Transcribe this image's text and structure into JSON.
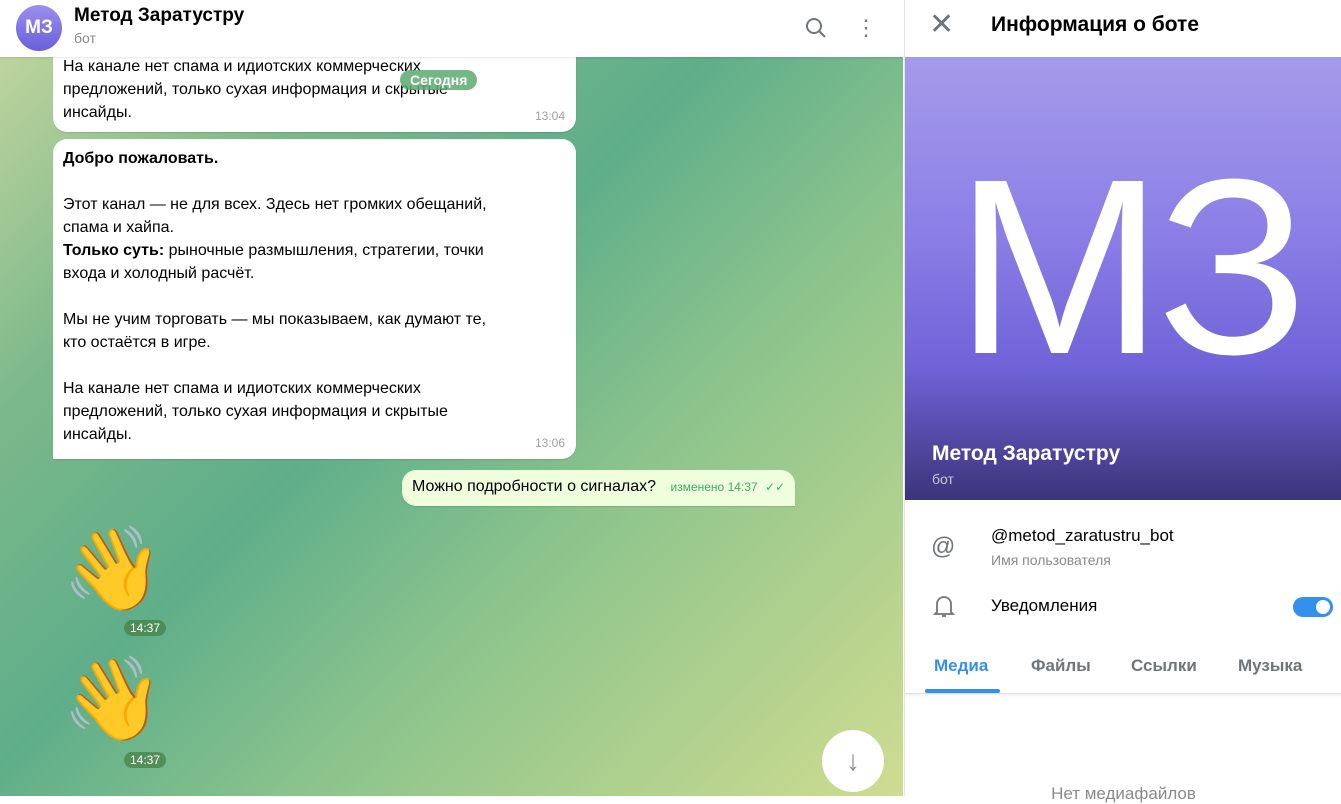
{
  "chat": {
    "avatar_initials": "МЗ",
    "title": "Метод Заратустру",
    "subtitle": "бот",
    "date_pill": "Сегодня",
    "messages": [
      {
        "lines": [
          "На канале нет спама и идиотских коммерческих",
          "предложений, только сухая информация и скрытые",
          "инсайды."
        ],
        "time": "13:04"
      },
      {
        "title": "Добро пожаловать.",
        "p1": "Этот канал — не для всех. Здесь нет громких обещаний,",
        "p1b": "спама и хайпа.",
        "bold": "Только суть:",
        "p2": " рыночные размышления, стратегии, точки",
        "p2b": "входа и холодный расчёт.",
        "p3": "Мы не учим торговать — мы показываем, как думают те,",
        "p3b": "кто остаётся в игре.",
        "p4": "На канале нет спама и идиотских коммерческих",
        "p4b": "предложений, только сухая информация и скрытые",
        "p4c": "инсайды.",
        "time": "13:06"
      },
      {
        "text": "Можно подробности о сигналах?",
        "meta": "изменено 14:37",
        "check": "✓✓"
      }
    ],
    "stickers": [
      {
        "emoji": "👋",
        "time": "14:37"
      },
      {
        "emoji": "👋",
        "time": "14:37"
      }
    ],
    "icons": {
      "search": "⌕",
      "menu": "⋮",
      "scroll_down": "↓"
    }
  },
  "panel": {
    "close": "✕",
    "title": "Информация о боте",
    "hero_initials": "МЗ",
    "name": "Метод Заратустру",
    "subtitle": "бот",
    "username": "@metod_zaratustru_bot",
    "username_label": "Имя пользователя",
    "at_icon": "@",
    "bell_icon": "🔔",
    "notifications": "Уведомления",
    "notifications_on": true,
    "tabs": [
      "Медиа",
      "Файлы",
      "Ссылки",
      "Музыка"
    ],
    "empty": "Нет медиафайлов"
  }
}
